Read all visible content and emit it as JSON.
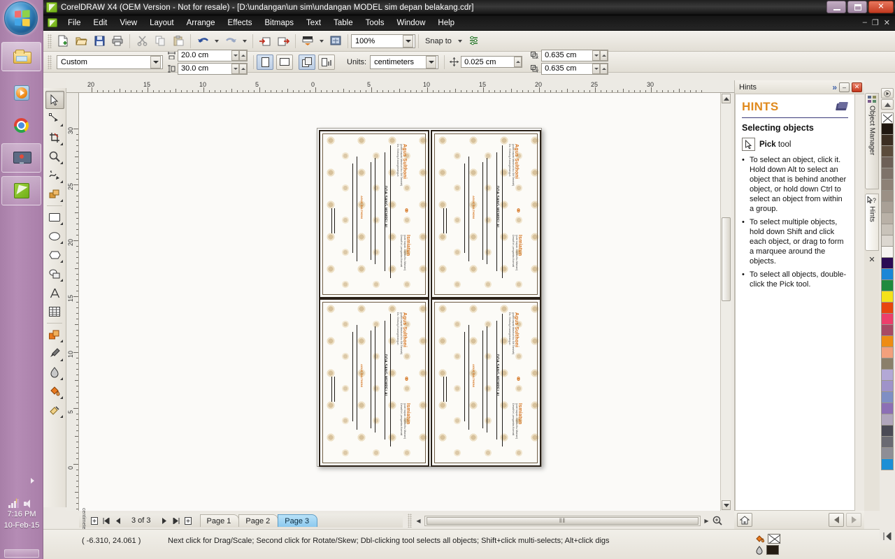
{
  "window": {
    "title": "CorelDRAW X4 (OEM Version - Not for resale) - [D:\\undangan\\un sim\\undangan MODEL  sim depan belakang.cdr]",
    "minimize": "–",
    "maximize": "□",
    "close": "✕",
    "doc_minimize": "–",
    "doc_restore": "❐",
    "doc_close": "✕"
  },
  "menu": {
    "items": [
      {
        "label": "File"
      },
      {
        "label": "Edit"
      },
      {
        "label": "View"
      },
      {
        "label": "Layout"
      },
      {
        "label": "Arrange"
      },
      {
        "label": "Effects"
      },
      {
        "label": "Bitmaps"
      },
      {
        "label": "Text"
      },
      {
        "label": "Table"
      },
      {
        "label": "Tools"
      },
      {
        "label": "Window"
      },
      {
        "label": "Help"
      }
    ]
  },
  "standard_toolbar": {
    "buttons": [
      {
        "name": "new-document-button",
        "icon": "new-file-icon"
      },
      {
        "name": "open-document-button",
        "icon": "open-folder-icon"
      },
      {
        "name": "save-document-button",
        "icon": "save-disk-icon"
      },
      {
        "name": "print-button",
        "icon": "printer-icon"
      },
      {
        "name": "cut-button",
        "icon": "scissors-icon"
      },
      {
        "name": "copy-button",
        "icon": "copy-icon"
      },
      {
        "name": "paste-button",
        "icon": "paste-icon"
      },
      {
        "name": "undo-button",
        "icon": "undo-arrow-icon"
      },
      {
        "name": "redo-button",
        "icon": "redo-arrow-icon"
      },
      {
        "name": "import-button",
        "icon": "import-icon"
      },
      {
        "name": "export-button",
        "icon": "export-icon"
      },
      {
        "name": "application-launcher-button",
        "icon": "launcher-icon"
      },
      {
        "name": "corel-online-button",
        "icon": "globe-icon"
      }
    ],
    "zoom_level": "100%",
    "snap_to_label": "Snap to",
    "options_button": "options-icon"
  },
  "property_bar": {
    "paper_type": "Custom",
    "page_width": "20.0 cm",
    "page_height": "30.0 cm",
    "orientation_portrait": "portrait-icon",
    "orientation_landscape": "landscape-icon",
    "all_pages_button": "all-pages-icon",
    "current_page_button": "current-page-icon",
    "units_label": "Units:",
    "units_value": "centimeters",
    "nudge_offset": "0.025 cm",
    "duplicate_x": "0.635 cm",
    "duplicate_y": "0.635 cm"
  },
  "toolbox": {
    "tools": [
      {
        "name": "pick-tool",
        "selected": true,
        "flyout": false
      },
      {
        "name": "shape-tool",
        "selected": false,
        "flyout": true
      },
      {
        "name": "crop-tool",
        "selected": false,
        "flyout": true
      },
      {
        "name": "zoom-tool",
        "selected": false,
        "flyout": true
      },
      {
        "name": "freehand-tool",
        "selected": false,
        "flyout": true
      },
      {
        "name": "smart-fill-tool",
        "selected": false,
        "flyout": true
      },
      {
        "name": "rectangle-tool",
        "selected": false,
        "flyout": true
      },
      {
        "name": "ellipse-tool",
        "selected": false,
        "flyout": true
      },
      {
        "name": "polygon-tool",
        "selected": false,
        "flyout": true
      },
      {
        "name": "basic-shapes-tool",
        "selected": false,
        "flyout": true
      },
      {
        "name": "text-tool",
        "selected": false,
        "flyout": false
      },
      {
        "name": "table-tool",
        "selected": false,
        "flyout": false
      },
      {
        "name": "interactive-blend-tool",
        "selected": false,
        "flyout": true
      },
      {
        "name": "eyedropper-tool",
        "selected": false,
        "flyout": true
      },
      {
        "name": "outline-tool",
        "selected": false,
        "flyout": true
      },
      {
        "name": "fill-tool",
        "selected": false,
        "flyout": true
      },
      {
        "name": "interactive-fill-tool",
        "selected": false,
        "flyout": true
      }
    ]
  },
  "rulers": {
    "horizontal_ticks": [
      "20",
      "15",
      "10",
      "5",
      "0",
      "5",
      "10",
      "15",
      "20",
      "25",
      "30"
    ],
    "horizontal_unit": "centimeters",
    "vertical_ticks": [
      "30",
      "25",
      "20",
      "15",
      "10",
      "5",
      "0"
    ],
    "vertical_unit": "centimeters"
  },
  "document": {
    "cards": [
      {
        "bride_groom": "Agus Sulthoni",
        "subtitle": "(putra bapak Mashuri/ibu Siti Tarwiah)",
        "address": "Ds. Gintung-Karangbinangun",
        "prayer_heading": "DOA SANG MEMPELAI",
        "partner": "Ismiatun",
        "partner_subtitle": "(putri bapak Juwoto/ibu Mariani)",
        "partner_address": "Desa/Kel. pengantar-Kormati",
        "side_text": "AGUS SULTHONI"
      },
      {
        "bride_groom": "Agus Sulthoni",
        "subtitle": "(putra bapak Mashuri/ibu Siti Tarwiah)",
        "address": "Ds. Gintung-Karangbinangun",
        "prayer_heading": "DOA SANG MEMPELAI",
        "partner": "Ismiatun",
        "partner_subtitle": "(putri bapak Juwoto/ibu Mariani)",
        "partner_address": "Desa/Kel. pengantar-Kormati",
        "side_text": "AGUS SULTHONI"
      },
      {
        "bride_groom": "Agus Sulthoni",
        "subtitle": "(putra bapak Mashuri/ibu Siti Tarwiah)",
        "address": "Ds. Gintung-Karangbinangun",
        "prayer_heading": "DOA SANG MEMPELAI",
        "partner": "Ismiatun",
        "partner_subtitle": "(putri bapak Juwoto/ibu Mariani)",
        "partner_address": "Desa/Kel. pengantar-Kormati",
        "side_text": "AGUS SULTHONI"
      },
      {
        "bride_groom": "Agus Sulthoni",
        "subtitle": "(putra bapak Mashuri/ibu Siti Tarwiah)",
        "address": "Ds. Gintung-Karangbinangun",
        "prayer_heading": "DOA SANG MEMPELAI",
        "partner": "Ismiatun",
        "partner_subtitle": "(putri bapak Juwoto/ibu Mariani)",
        "partner_address": "Desa/Kel. pengantar-Kormati",
        "side_text": "AGUS SULTHONI"
      }
    ]
  },
  "page_navigator": {
    "page_counter": "3 of 3",
    "add_page_start": "add-page-icon",
    "first_page": "first-page-icon",
    "prev_page": "prev-page-icon",
    "next_page": "next-page-icon",
    "last_page": "last-page-icon",
    "add_page_end": "add-page-icon",
    "tabs": [
      {
        "label": "Page 1",
        "active": false
      },
      {
        "label": "Page 2",
        "active": false
      },
      {
        "label": "Page 3",
        "active": true
      }
    ],
    "scroll_grip": "‖‖",
    "zoom_icon": "zoom-magnifier-icon"
  },
  "status_bar": {
    "coordinates": "( -6.310, 24.061 )",
    "hint": "Next click for Drag/Scale; Second click for Rotate/Skew; Dbl-clicking tool selects all objects; Shift+click multi-selects; Alt+click digs",
    "fill_swatch_label": "fill-color-swatch",
    "outline_swatch_label": "outline-color-swatch",
    "fill_color": "#FFFFFF",
    "outline_color": "#241c12"
  },
  "docker": {
    "title": "Hints",
    "expand_button": "»",
    "minimize_button": "–",
    "close_button": "✕",
    "heading": "HINTS",
    "book_icon": "book-icon",
    "subheading": "Selecting objects",
    "tool_label_prefix": "Pick",
    "tool_label_suffix": " tool",
    "bullets": [
      {
        "text": "To select an object, click it. Hold down Alt to select an object that is behind another object, or hold down Ctrl to select an object from within a group."
      },
      {
        "text": "To select multiple objects, hold down Shift and click each object, or drag to form a marquee around the objects."
      },
      {
        "text": "To select all objects, double-click the Pick tool."
      }
    ],
    "tabs": [
      {
        "label": "Object Manager",
        "icon": "object-manager-icon",
        "active": false
      },
      {
        "label": "Hints",
        "icon": "hints-pointer-icon",
        "active": true
      }
    ],
    "close_tab": "✕"
  },
  "navigator_corner": {
    "home_button": "home-icon",
    "back_button": "back-arrow-icon",
    "forward_button": "forward-arrow-icon"
  },
  "palette": {
    "scroll_up": "▲",
    "scroll_down": "▼",
    "colors": [
      "none",
      "#1f1710",
      "#3b2e22",
      "#5b4c3c",
      "#6d6057",
      "#7e736a",
      "#8d8176",
      "#9b9085",
      "#a9a096",
      "#b9b1a7",
      "#c9c3ba",
      "#dcd7d0",
      "#f7f5f2",
      "#2b0b54",
      "#1b86d6",
      "#1f8a3e",
      "#f4e21a",
      "#e8450f",
      "#ec3f6b",
      "#a84a64",
      "#ee8c14",
      "#f2a07c",
      "#8a7f6a",
      "#b3a8d6",
      "#9f93c9",
      "#7f8fc4",
      "#8c6fb5",
      "#b0a6bc",
      "#4a4a55",
      "#6a6a72",
      "#8e8e96",
      "#1d8fd6"
    ],
    "nav_icon": "palette-expand-icon"
  },
  "taskbar": {
    "start": "start-orb",
    "items": [
      {
        "name": "windows-explorer",
        "icon": "folder-icon",
        "active": true
      },
      {
        "name": "media-player",
        "icon": "media-player-icon",
        "active": false
      },
      {
        "name": "google-chrome",
        "icon": "chrome-icon",
        "active": false
      },
      {
        "name": "screen-capture",
        "icon": "monitor-icon",
        "active": true
      },
      {
        "name": "coreldraw",
        "icon": "coreldraw-icon",
        "active": true
      }
    ],
    "clock_time": "7:16 PM",
    "clock_date": "10-Feb-15",
    "tray": [
      "network-signal-icon",
      "volume-speaker-icon"
    ]
  }
}
